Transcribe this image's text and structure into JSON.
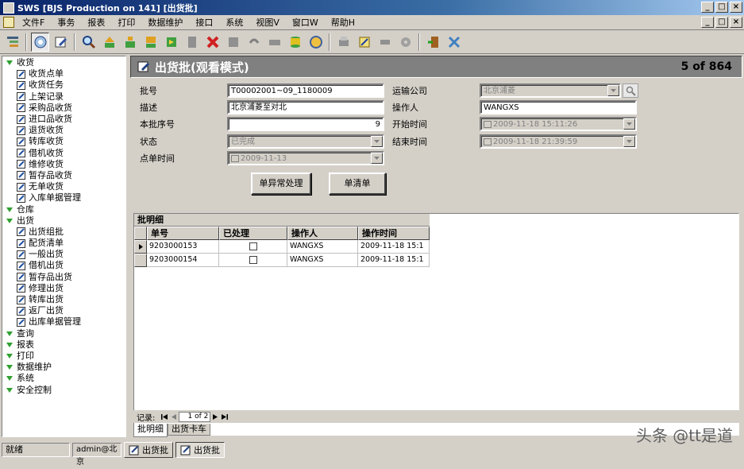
{
  "window": {
    "title": "SWS [BJS Production on 141]  [出货批]",
    "min": "_",
    "max": "□",
    "close": "×"
  },
  "menu": [
    "文件F",
    "事务",
    "报表",
    "打印",
    "数据维护",
    "接口",
    "系统",
    "视图V",
    "窗口W",
    "帮助H"
  ],
  "tree": [
    {
      "label": "收货",
      "level": 0
    },
    {
      "label": "收货点单",
      "level": 1
    },
    {
      "label": "收货任务",
      "level": 1
    },
    {
      "label": "上架记录",
      "level": 1
    },
    {
      "label": "采购品收货",
      "level": 1
    },
    {
      "label": "进口品收货",
      "level": 1
    },
    {
      "label": "退货收货",
      "level": 1
    },
    {
      "label": "转库收货",
      "level": 1
    },
    {
      "label": "借机收货",
      "level": 1
    },
    {
      "label": "维修收货",
      "level": 1
    },
    {
      "label": "暂存品收货",
      "level": 1
    },
    {
      "label": "无单收货",
      "level": 1
    },
    {
      "label": "入库单据管理",
      "level": 1
    },
    {
      "label": "仓库",
      "level": 0
    },
    {
      "label": "出货",
      "level": 0
    },
    {
      "label": "出货组批",
      "level": 1
    },
    {
      "label": "配货清单",
      "level": 1
    },
    {
      "label": "一般出货",
      "level": 1
    },
    {
      "label": "借机出货",
      "level": 1
    },
    {
      "label": "暂存品出货",
      "level": 1
    },
    {
      "label": "修理出货",
      "level": 1
    },
    {
      "label": "转库出货",
      "level": 1
    },
    {
      "label": "返厂出货",
      "level": 1
    },
    {
      "label": "出库单据管理",
      "level": 1
    },
    {
      "label": "查询",
      "level": 0
    },
    {
      "label": "报表",
      "level": 0
    },
    {
      "label": "打印",
      "level": 0
    },
    {
      "label": "数据维护",
      "level": 0
    },
    {
      "label": "系统",
      "level": 0
    },
    {
      "label": "安全控制",
      "level": 0
    }
  ],
  "header": {
    "title": "出货批(观看模式)",
    "count": "5 of 864"
  },
  "form": {
    "batch_no_label": "批号",
    "batch_no": "T00002001~09_1180009",
    "desc_label": "描述",
    "desc": "北京浦菱至对北",
    "seq_label": "本批序号",
    "seq": "9",
    "status_label": "状态",
    "status": "已完成",
    "check_time_label": "点单时间",
    "check_time": "2009-11-13",
    "carrier_label": "运输公司",
    "carrier": "北京浦菱",
    "operator_label": "操作人",
    "operator": "WANGXS",
    "start_label": "开始时间",
    "start": "2009-11-18 15:11:26",
    "end_label": "结束时间",
    "end": "2009-11-18 21:39:59",
    "btn_exception": "单异常处理",
    "btn_list": "单清单"
  },
  "grid": {
    "caption": "批明细",
    "columns": [
      "单号",
      "已处理",
      "操作人",
      "操作时间"
    ],
    "rows": [
      {
        "no": "9203000153",
        "operator": "WANGXS",
        "time": "2009-11-18 15:1"
      },
      {
        "no": "9203000154",
        "operator": "WANGXS",
        "time": "2009-11-18 15:1"
      }
    ]
  },
  "nav": {
    "record_label": "记录:",
    "page": "1 of 2"
  },
  "tabs": [
    "批明细",
    "出货卡车"
  ],
  "status": {
    "ready": "就绪",
    "user": "admin@北京",
    "task1": "出货批",
    "task2": "出货批"
  },
  "watermark": "头条 @tt是道"
}
